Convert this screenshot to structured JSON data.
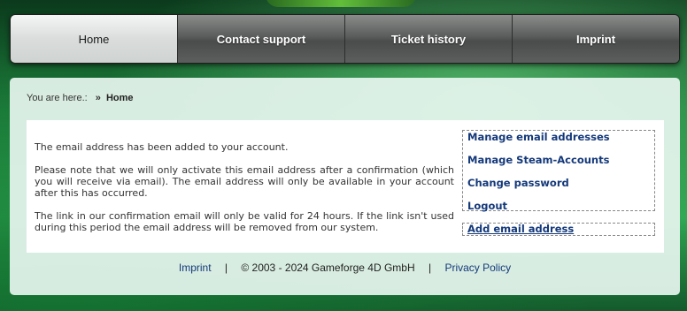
{
  "nav": {
    "items": [
      {
        "label": "Home",
        "active": true
      },
      {
        "label": "Contact support"
      },
      {
        "label": "Ticket history"
      },
      {
        "label": "Imprint"
      }
    ]
  },
  "breadcrumb": {
    "prefix": "You are here.:",
    "separator": "»",
    "current": "Home"
  },
  "message": {
    "line1": "The email address has been added to your account.",
    "line2": "Please note that we will only activate this email address after a confirmation (which you will receive via email). The email address will only be available in your account after this has occurred.",
    "line3": "The link in our confirmation email will only be valid for 24 hours. If the link isn't used during this period the email address will be removed from our system."
  },
  "sidebar": {
    "links": [
      "Manage email addresses",
      "Manage Steam-Accounts",
      "Change password",
      "Logout"
    ],
    "add_email": "Add email address"
  },
  "footer": {
    "imprint": "Imprint",
    "copyright": "© 2003 - 2024 Gameforge 4D GmbH",
    "privacy": "Privacy Policy",
    "separator": "|"
  },
  "colors": {
    "link": "#14397a",
    "panel": "#e8f6f0",
    "nav_active": "#e4e7e6",
    "nav_inactive": "#5b5d5c"
  }
}
